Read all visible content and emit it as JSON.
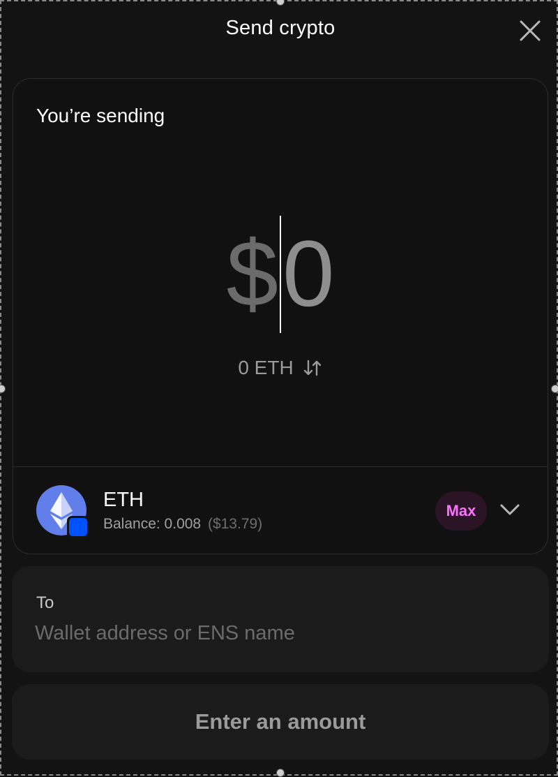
{
  "header": {
    "title": "Send crypto"
  },
  "send": {
    "label": "You’re sending",
    "currency_symbol": "$",
    "amount": "0",
    "equivalent": "0 ETH"
  },
  "token": {
    "symbol": "ETH",
    "balance_label": "Balance: 0.008",
    "balance_usd": "($13.79)",
    "max_label": "Max"
  },
  "recipient": {
    "label": "To",
    "value": "",
    "placeholder": "Wallet address or ENS name"
  },
  "action": {
    "button_label": "Enter an amount"
  },
  "icons": {
    "close": "close-icon",
    "swap": "swap-arrows-icon",
    "token": "ethereum-icon",
    "network_badge": "network-badge-icon",
    "chevron": "chevron-down-icon"
  },
  "colors": {
    "background": "#131313",
    "accent": "#fc72ff",
    "eth_blue": "#627eea",
    "badge_blue": "#0052ff"
  }
}
